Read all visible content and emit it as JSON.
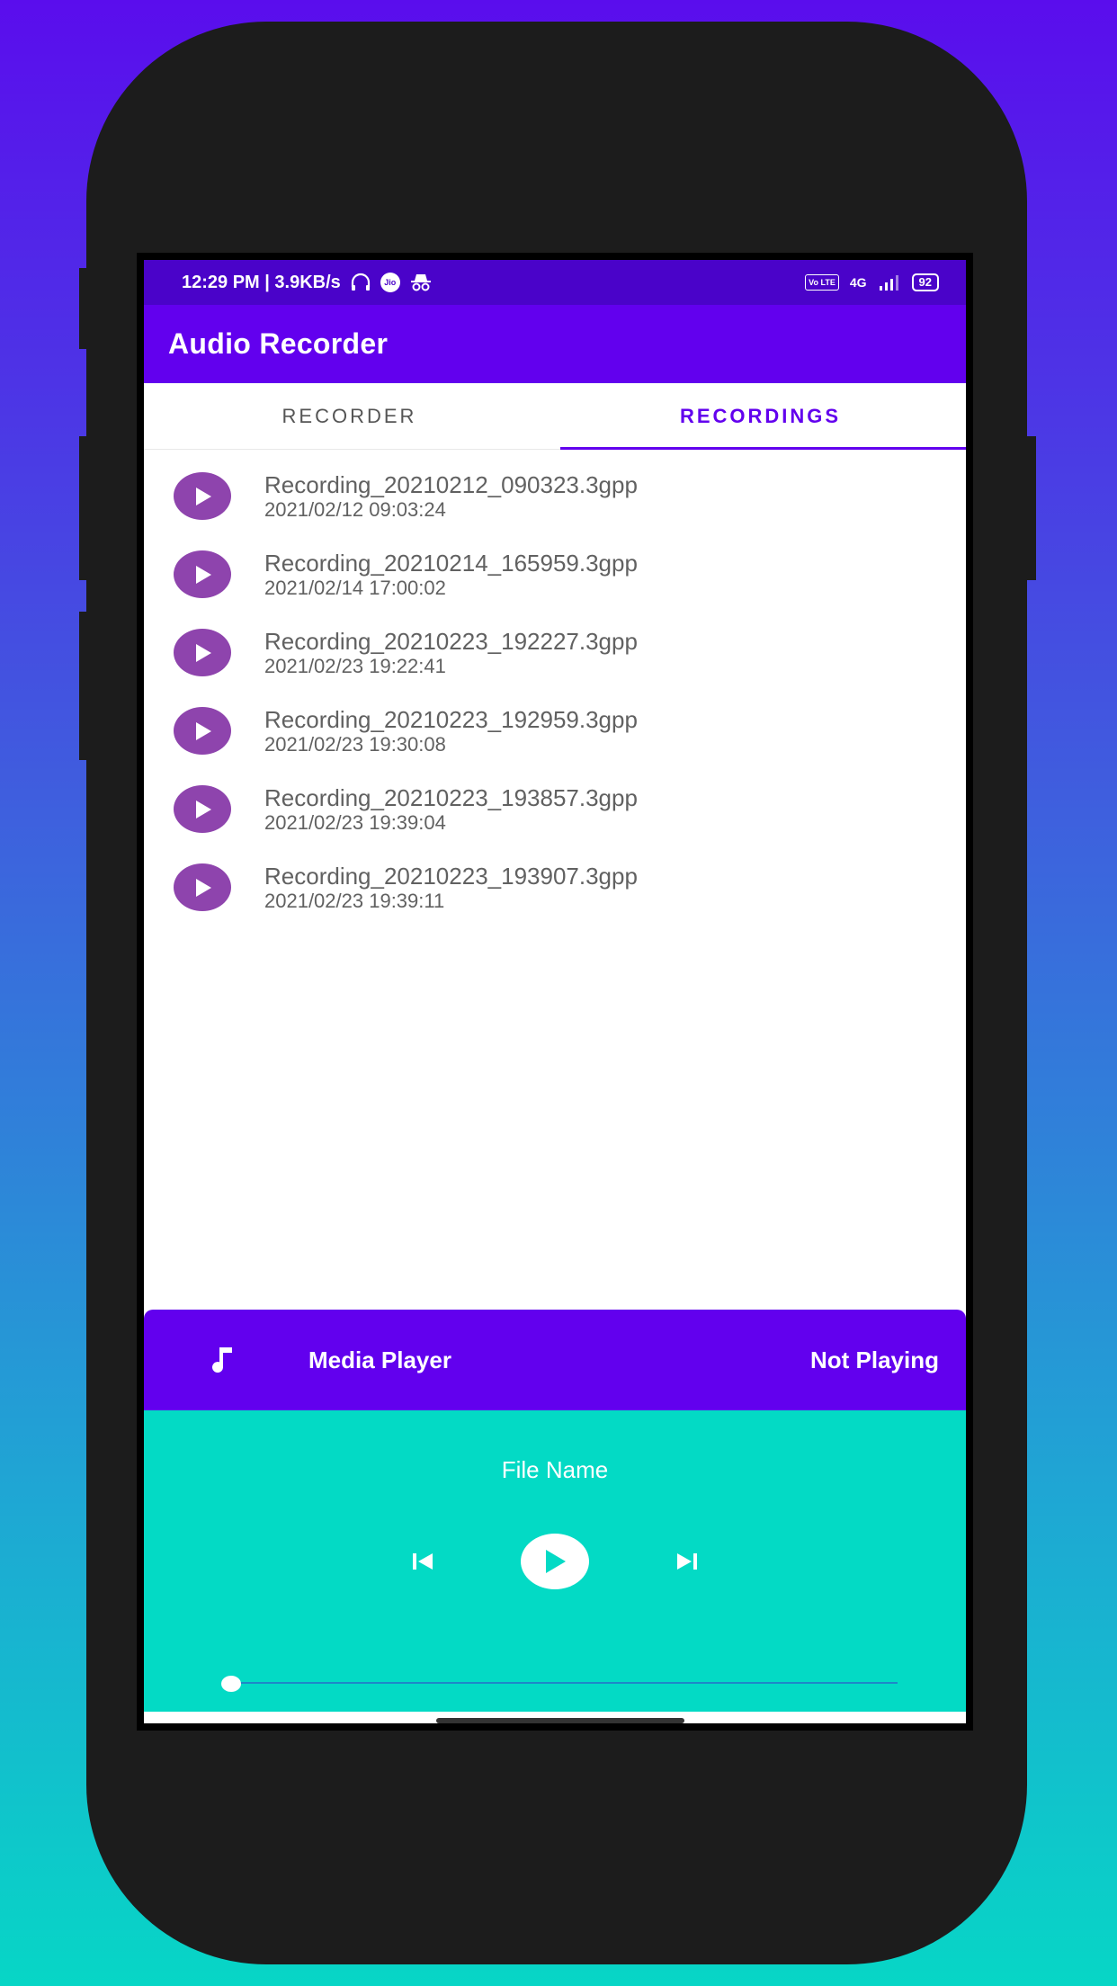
{
  "colors": {
    "status_bar": "#4a03c9",
    "app_bar": "#6200ee",
    "accent": "#6200ee",
    "play_button": "#8e44ad",
    "player_body": "#03dac5"
  },
  "status_bar": {
    "time_speed": "12:29 PM | 3.9KB/s",
    "jio": "Jio",
    "volte": "Vo LTE",
    "network": "4G",
    "battery": "92"
  },
  "app_bar": {
    "title": "Audio Recorder"
  },
  "tabs": [
    {
      "label": "RECORDER",
      "active": false
    },
    {
      "label": "RECORDINGS",
      "active": true
    }
  ],
  "recordings": [
    {
      "name": "Recording_20210212_090323.3gpp",
      "date": "2021/02/12 09:03:24"
    },
    {
      "name": "Recording_20210214_165959.3gpp",
      "date": "2021/02/14 17:00:02"
    },
    {
      "name": "Recording_20210223_192227.3gpp",
      "date": "2021/02/23 19:22:41"
    },
    {
      "name": "Recording_20210223_192959.3gpp",
      "date": "2021/02/23 19:30:08"
    },
    {
      "name": "Recording_20210223_193857.3gpp",
      "date": "2021/02/23 19:39:04"
    },
    {
      "name": "Recording_20210223_193907.3gpp",
      "date": "2021/02/23 19:39:11"
    }
  ],
  "player": {
    "title": "Media Player",
    "status": "Not Playing",
    "file_name": "File Name",
    "progress": 0,
    "icons": [
      "music-note-icon",
      "skip-previous-icon",
      "play-icon",
      "skip-next-icon"
    ]
  }
}
